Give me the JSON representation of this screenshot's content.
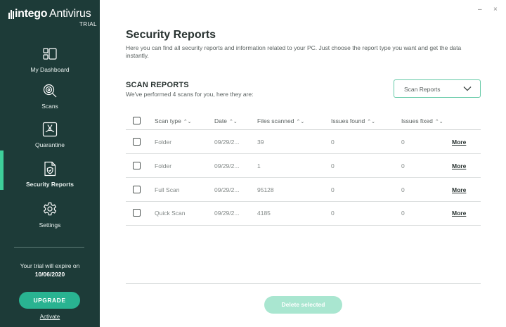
{
  "app": {
    "brand": "intego",
    "product": "Antivirus",
    "edition": "TRIAL"
  },
  "sidebar": {
    "items": [
      {
        "label": "My Dashboard",
        "icon": "dashboard-icon"
      },
      {
        "label": "Scans",
        "icon": "scan-icon"
      },
      {
        "label": "Quarantine",
        "icon": "quarantine-icon"
      },
      {
        "label": "Security Reports",
        "icon": "security-reports-icon",
        "active": true
      },
      {
        "label": "Settings",
        "icon": "gear-icon"
      }
    ],
    "trial_text": "Your trial will expire on",
    "trial_date": "10/06/2020",
    "upgrade_label": "UPGRADE",
    "activate_label": "Activate"
  },
  "window": {
    "minimize": "–",
    "close": "×"
  },
  "main": {
    "title": "Security Reports",
    "description": "Here you can find all security reports and information related to your PC. Just choose the report type you want and get the data instantly.",
    "section_title": "SCAN REPORTS",
    "section_subtitle": "We've performed 4 scans for you, here they are:",
    "dropdown_value": "Scan Reports",
    "columns": [
      "Scan type",
      "Date",
      "Files scanned",
      "Issues found",
      "Issues fixed"
    ],
    "rows": [
      {
        "type": "Folder",
        "date": "09/29/2...",
        "files": "39",
        "found": "0",
        "fixed": "0",
        "action": "More"
      },
      {
        "type": "Folder",
        "date": "09/29/2...",
        "files": "1",
        "found": "0",
        "fixed": "0",
        "action": "More"
      },
      {
        "type": "Full Scan",
        "date": "09/29/2...",
        "files": "95128",
        "found": "0",
        "fixed": "0",
        "action": "More"
      },
      {
        "type": "Quick Scan",
        "date": "09/29/2...",
        "files": "4185",
        "found": "0",
        "fixed": "0",
        "action": "More"
      }
    ],
    "delete_label": "Delete selected"
  },
  "colors": {
    "sidebar_bg": "#1d3b38",
    "accent": "#29b391",
    "active_bar": "#3ecf9a",
    "disabled_button": "#a9e6d0"
  }
}
